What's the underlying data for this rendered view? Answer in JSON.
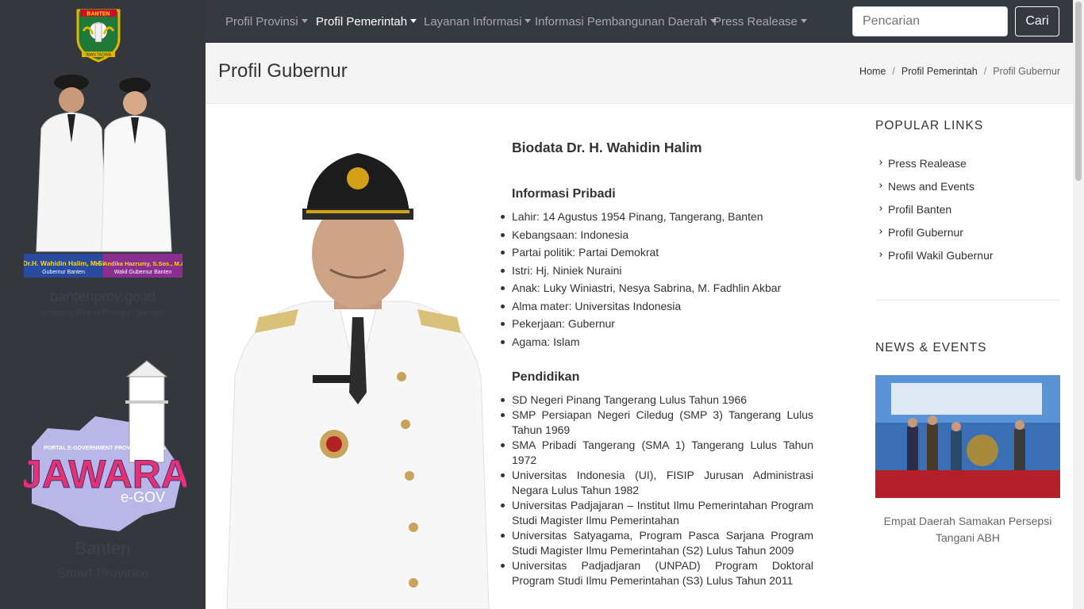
{
  "sidebar": {
    "crest_text": "BANTEN",
    "crest_motto": "IMAN TAQWA",
    "official_1_caption": "Dr.H. Wahidin Halim, M.Si",
    "official_1_role": "Gubernur Banten",
    "official_2_caption": "H. Andika Hazrumy, S.Sos., M.AP.",
    "official_2_role": "Wakil Gubernur Banten",
    "site_name": "bantenprov.go.id",
    "site_tagline": "Website Resmi Provinsi Banten",
    "jawara_header": "PORTAL E-GOVERNMENT PROVINSI BANTEN",
    "jawara_logo_text": "JAWARA",
    "jawara_sub": "e-GOV",
    "brand_name": "Banten",
    "brand_tagline": "Smart Province"
  },
  "nav": {
    "items": [
      {
        "label": "Profil Provinsi"
      },
      {
        "label": "Profil Pemerintah"
      },
      {
        "label": "Layanan Informasi"
      },
      {
        "label": "Informasi Pembangunan Daerah"
      },
      {
        "label": "Press Realease"
      }
    ],
    "search_placeholder": "Pencarian",
    "search_button": "Cari"
  },
  "header": {
    "title": "Profil Gubernur",
    "breadcrumb": [
      "Home",
      "Profil Pemerintah",
      "Profil Gubernur"
    ]
  },
  "bio": {
    "heading": "Biodata Dr. H. Wahidin Halim",
    "personal_heading": "Informasi Pribadi",
    "personal": [
      "Lahir: 14 Agustus 1954 Pinang, Tangerang, Banten",
      "Kebangsaan: Indonesia",
      "Partai politik: Partai Demokrat",
      "Istri: Hj. Niniek Nuraini",
      "Anak: Luky Winiastri, Nesya Sabrina, M. Fadhlin Akbar",
      "Alma mater: Universitas Indonesia",
      "Pekerjaan: Gubernur",
      "Agama: Islam"
    ],
    "education_heading": "Pendidikan",
    "education": [
      "SD Negeri Pinang Tangerang Lulus Tahun 1966",
      "SMP Persiapan Negeri Ciledug (SMP 3) Tangerang Lulus Tahun 1969",
      "SMA Pribadi Tangerang (SMA 1) Tangerang Lulus Tahun 1972",
      "Universitas Indonesia (UI), FISIP Jurusan Administrasi Negara Lulus Tahun 1982",
      "Universitas Padjajaran – Institut Ilmu Pemerintahan Program Studi Magister Ilmu Pemerintahan",
      "Universitas Satyagama, Program Pasca Sarjana Program Studi Magister Ilmu Pemerintahan (S2) Lulus Tahun 2009",
      "Universitas Padjadjaran (UNPAD) Program Doktoral Program Studi Ilmu Pemerintahan (S3) Lulus Tahun 2011"
    ]
  },
  "right": {
    "popular_title": "POPULAR LINKS",
    "links": [
      "Press Realease",
      "News and Events",
      "Profil Banten",
      "Profil Gubernur",
      "Profil Wakil Gubernur"
    ],
    "news_title": "NEWS & EVENTS",
    "news_caption": "Empat Daerah Samakan Persepsi Tangani ABH"
  },
  "colors": {
    "sidebar_bg": "#34373c",
    "nav_bg": "#343a40",
    "header_bg": "#f4f4f4"
  }
}
